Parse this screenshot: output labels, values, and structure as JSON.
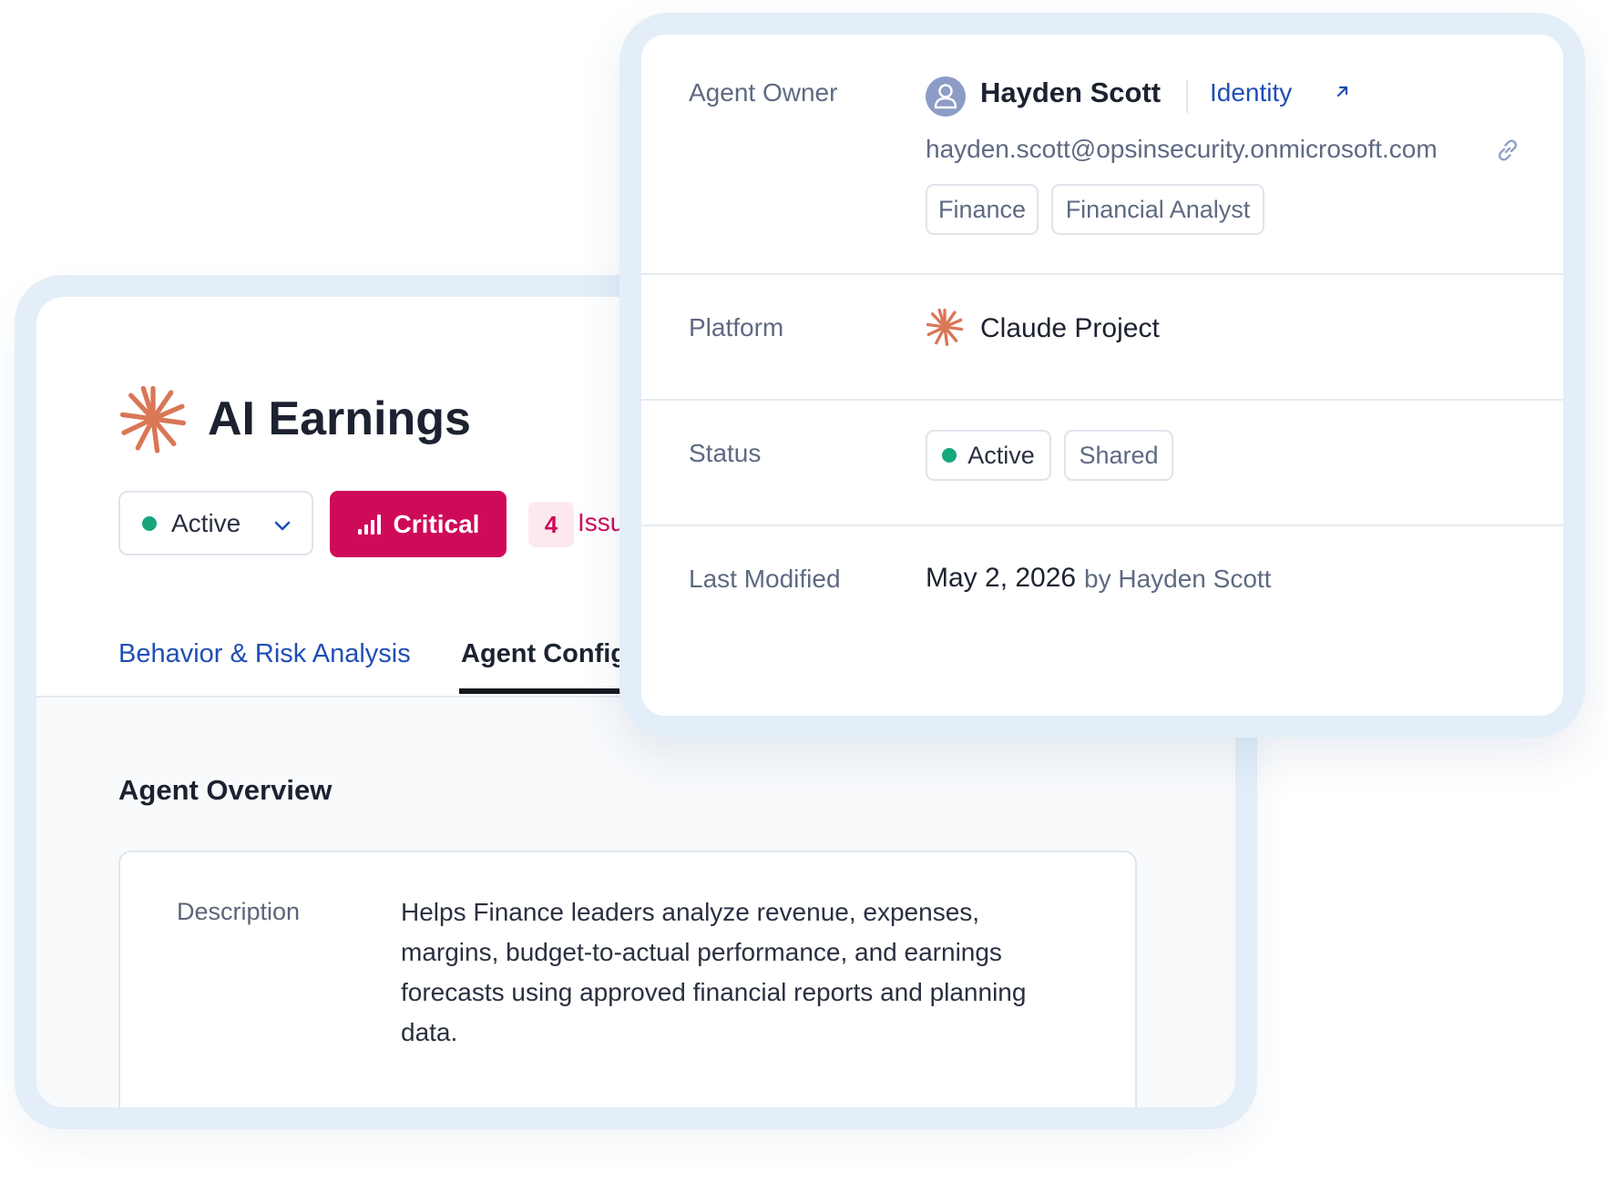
{
  "agent": {
    "name": "AI Earnings",
    "status_select": "Active",
    "risk_level": "Critical",
    "issues_count": "4",
    "issues_label": "Issu"
  },
  "tabs": [
    {
      "label": "Behavior & Risk Analysis",
      "active": false
    },
    {
      "label": "Agent Config",
      "active": true
    }
  ],
  "overview": {
    "title": "Agent Overview",
    "description_label": "Description",
    "description": "Helps Finance leaders analyze revenue, expenses, margins, budget-to-actual performance, and earnings forecasts using approved financial reports and planning data."
  },
  "details": {
    "owner": {
      "label": "Agent Owner",
      "name": "Hayden Scott",
      "identity_link": "Identity",
      "email": "hayden.scott@opsinsecurity.onmicrosoft.com",
      "tags": [
        "Finance",
        "Financial Analyst"
      ]
    },
    "platform": {
      "label": "Platform",
      "value": "Claude Project"
    },
    "status": {
      "label": "Status",
      "active": "Active",
      "shared": "Shared"
    },
    "last_modified": {
      "label": "Last Modified",
      "date": "May 2, 2026",
      "by": "by Hayden Scott"
    }
  },
  "colors": {
    "accent_blue": "#1f4fb4",
    "critical": "#cf0a59",
    "active_green": "#17a57e",
    "claude_orange": "#d97757",
    "frame": "#e3eef8"
  },
  "icons": [
    "claude-logo-icon",
    "chevron-down-icon",
    "signal-bars-icon",
    "user-avatar-icon",
    "external-arrow-icon",
    "link-icon"
  ]
}
